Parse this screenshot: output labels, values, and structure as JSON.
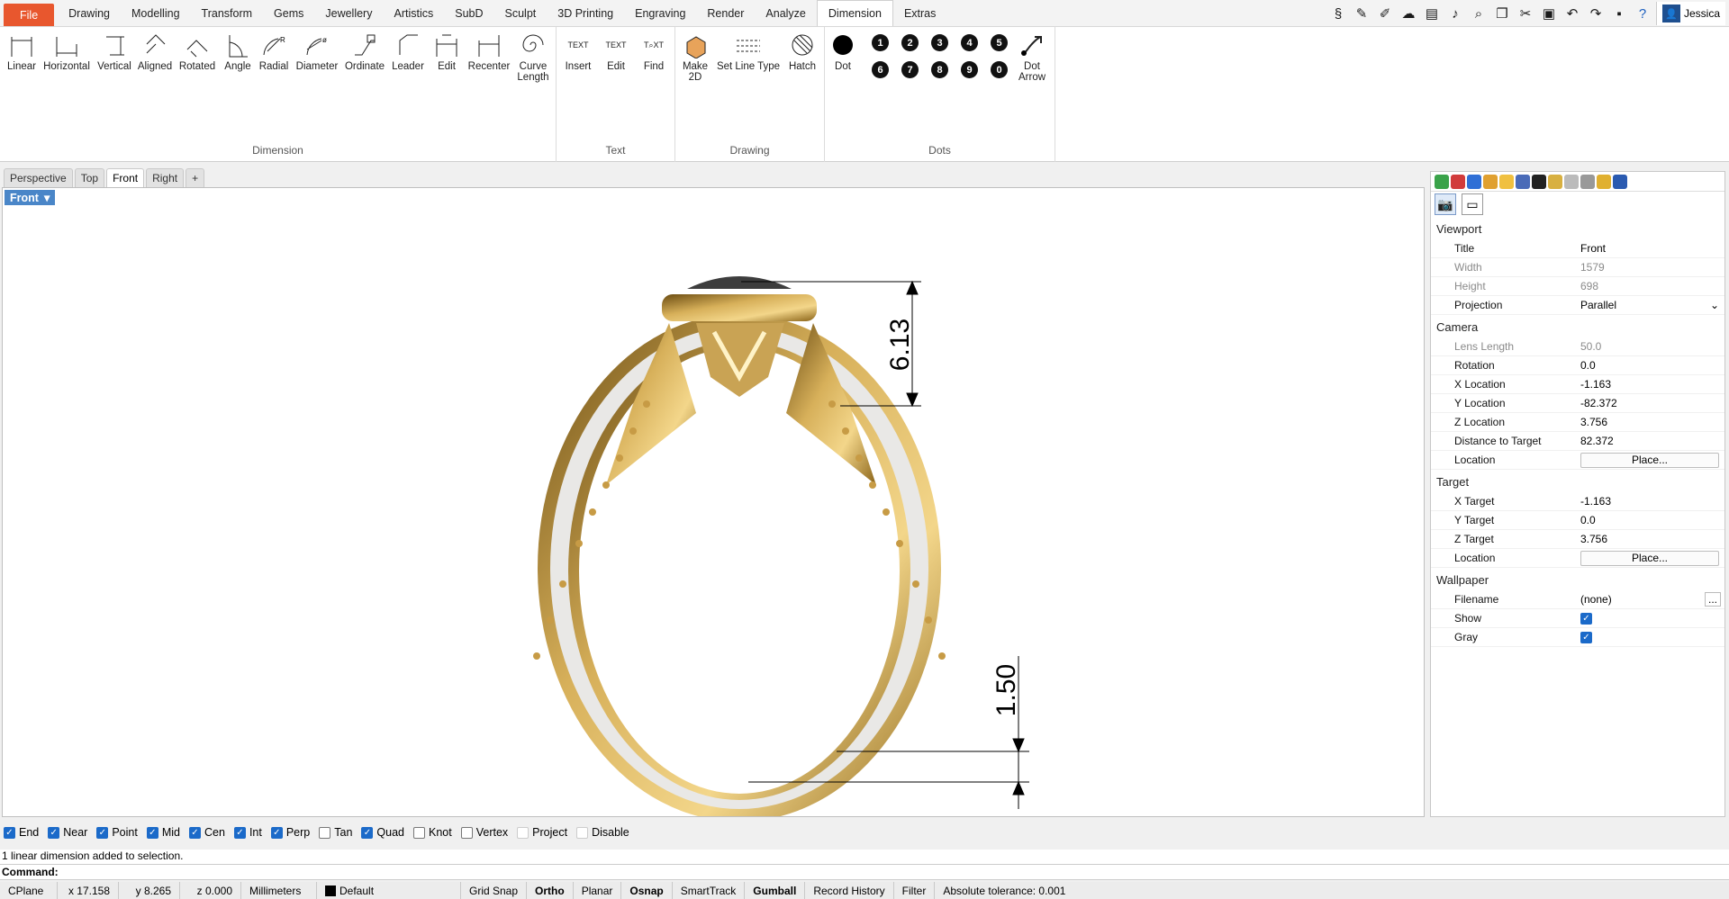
{
  "menu": {
    "file": "File",
    "items": [
      "Drawing",
      "Modelling",
      "Transform",
      "Gems",
      "Jewellery",
      "Artistics",
      "SubD",
      "Sculpt",
      "3D Printing",
      "Engraving",
      "Render",
      "Analyze",
      "Dimension",
      "Extras"
    ],
    "active": "Dimension",
    "user": "Jessica"
  },
  "ribbon": {
    "dimension_group": "Dimension",
    "text_group": "Text",
    "drawing_group": "Drawing",
    "dots_group": "Dots",
    "tools": {
      "linear": "Linear",
      "horizontal": "Horizontal",
      "vertical": "Vertical",
      "aligned": "Aligned",
      "rotated": "Rotated",
      "angle": "Angle",
      "radial": "Radial",
      "diameter": "Diameter",
      "ordinate": "Ordinate",
      "leader": "Leader",
      "edit": "Edit",
      "recenter": "Recenter",
      "curve_length_1": "Curve",
      "curve_length_2": "Length",
      "insert": "Insert",
      "text_edit": "Edit",
      "find": "Find",
      "make2d_1": "Make",
      "make2d_2": "2D",
      "set_line_type": "Set Line Type",
      "hatch": "Hatch",
      "dot": "Dot",
      "dot_arrow_1": "Dot",
      "dot_arrow_2": "Arrow"
    },
    "dot_numbers": [
      "1",
      "2",
      "3",
      "4",
      "5",
      "6",
      "7",
      "8",
      "9",
      "0"
    ]
  },
  "viewport_tabs": [
    "Perspective",
    "Top",
    "Front",
    "Right"
  ],
  "active_viewport": "Front",
  "viewport_label": "Front",
  "dimensions": {
    "top": "6.13",
    "bottom": "1.50"
  },
  "properties": {
    "viewport_section": "Viewport",
    "title_k": "Title",
    "title_v": "Front",
    "width_k": "Width",
    "width_v": "1579",
    "height_k": "Height",
    "height_v": "698",
    "projection_k": "Projection",
    "projection_v": "Parallel",
    "camera_section": "Camera",
    "lens_k": "Lens Length",
    "lens_v": "50.0",
    "rotation_k": "Rotation",
    "rotation_v": "0.0",
    "xloc_k": "X Location",
    "xloc_v": "-1.163",
    "yloc_k": "Y Location",
    "yloc_v": "-82.372",
    "zloc_k": "Z Location",
    "zloc_v": "3.756",
    "dist_k": "Distance to Target",
    "dist_v": "82.372",
    "loc_k": "Location",
    "place": "Place...",
    "target_section": "Target",
    "xt_k": "X Target",
    "xt_v": "-1.163",
    "yt_k": "Y Target",
    "yt_v": "0.0",
    "zt_k": "Z Target",
    "zt_v": "3.756",
    "wallpaper_section": "Wallpaper",
    "filename_k": "Filename",
    "filename_v": "(none)",
    "show_k": "Show",
    "gray_k": "Gray",
    "ellipsis": "..."
  },
  "osnap": [
    {
      "label": "End",
      "checked": true
    },
    {
      "label": "Near",
      "checked": true
    },
    {
      "label": "Point",
      "checked": true
    },
    {
      "label": "Mid",
      "checked": true
    },
    {
      "label": "Cen",
      "checked": true
    },
    {
      "label": "Int",
      "checked": true
    },
    {
      "label": "Perp",
      "checked": true
    },
    {
      "label": "Tan",
      "checked": false
    },
    {
      "label": "Quad",
      "checked": true
    },
    {
      "label": "Knot",
      "checked": false
    },
    {
      "label": "Vertex",
      "checked": false
    },
    {
      "label": "Project",
      "checked": false
    },
    {
      "label": "Disable",
      "checked": false
    }
  ],
  "command_history": "1 linear dimension added to selection.",
  "command_prompt": "Command:",
  "status": {
    "cplane": "CPlane",
    "x": "x 17.158",
    "y": "y 8.265",
    "z": "z 0.000",
    "units": "Millimeters",
    "layer": "Default",
    "grid_snap": "Grid Snap",
    "ortho": "Ortho",
    "planar": "Planar",
    "osnap": "Osnap",
    "smarttrack": "SmartTrack",
    "gumball": "Gumball",
    "record_history": "Record History",
    "filter": "Filter",
    "tolerance": "Absolute tolerance: 0.001"
  }
}
